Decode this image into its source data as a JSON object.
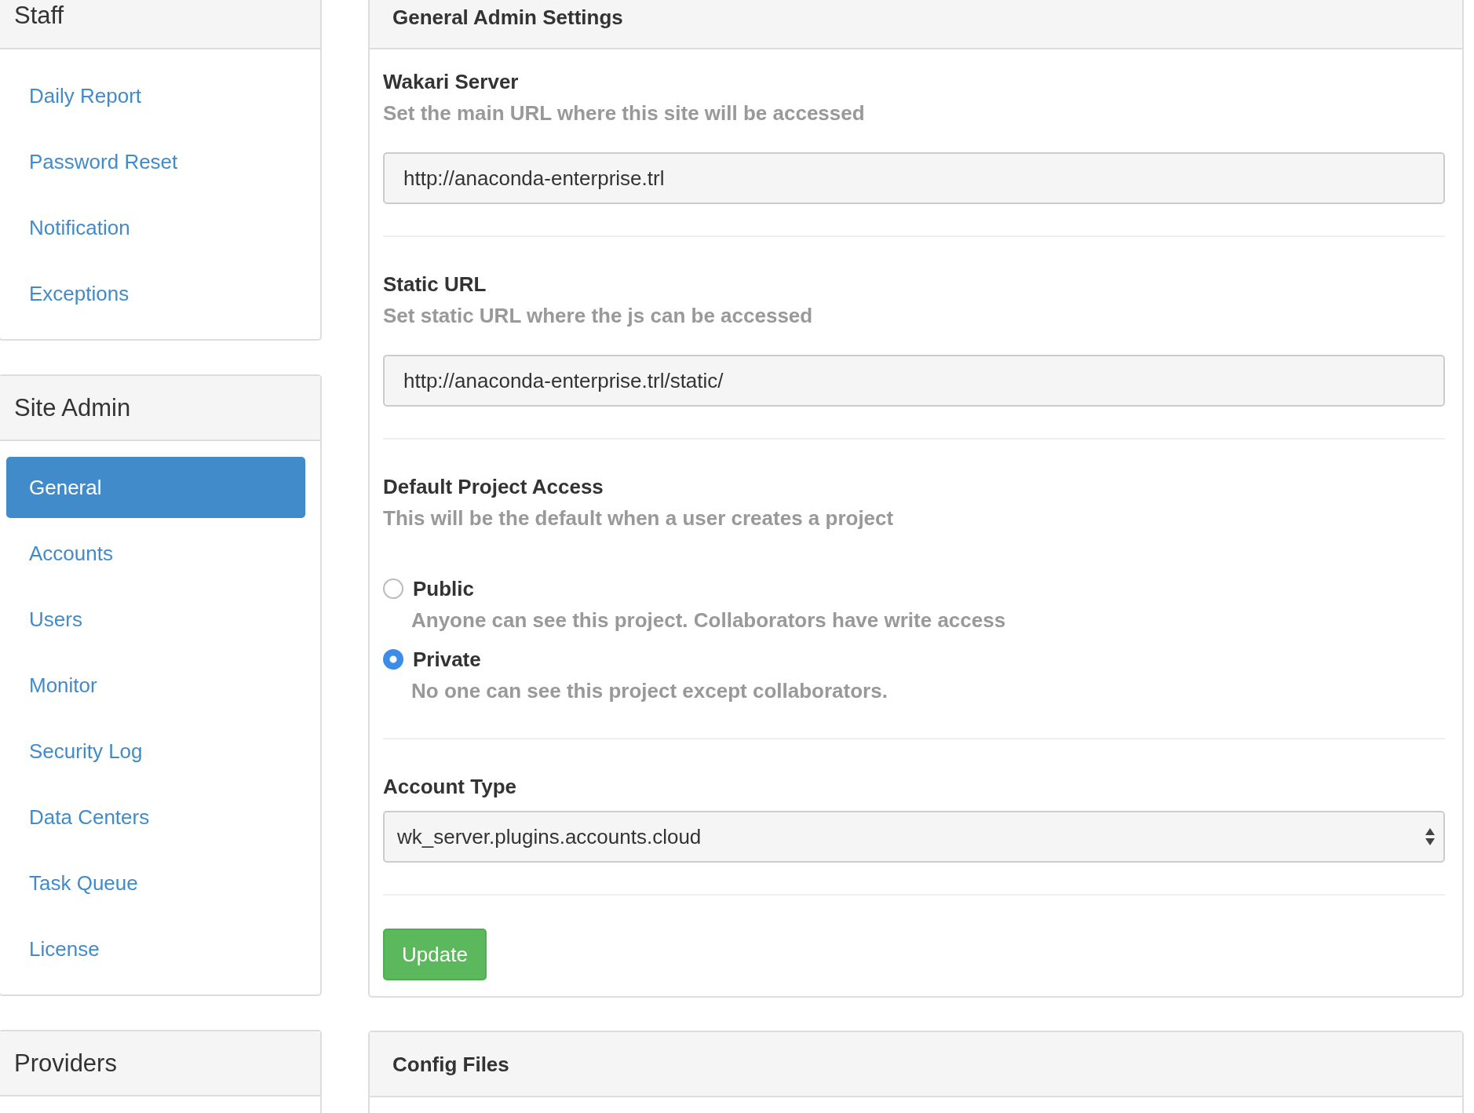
{
  "sidebar": [
    {
      "title": "Staff",
      "items": [
        {
          "label": "Daily Report",
          "selected": false
        },
        {
          "label": "Password Reset",
          "selected": false
        },
        {
          "label": "Notification",
          "selected": false
        },
        {
          "label": "Exceptions",
          "selected": false
        }
      ]
    },
    {
      "title": "Site Admin",
      "items": [
        {
          "label": "General",
          "selected": true
        },
        {
          "label": "Accounts",
          "selected": false
        },
        {
          "label": "Users",
          "selected": false
        },
        {
          "label": "Monitor",
          "selected": false
        },
        {
          "label": "Security Log",
          "selected": false
        },
        {
          "label": "Data Centers",
          "selected": false
        },
        {
          "label": "Task Queue",
          "selected": false
        },
        {
          "label": "License",
          "selected": false
        }
      ]
    },
    {
      "title": "Providers"
    }
  ],
  "general_panel": {
    "title": "General Admin Settings",
    "wakari_server": {
      "label": "Wakari Server",
      "help": "Set the main URL where this site will be accessed",
      "value": "http://anaconda-enterprise.trl"
    },
    "static_url": {
      "label": "Static URL",
      "help": "Set static URL where the js can be accessed",
      "value": "http://anaconda-enterprise.trl/static/"
    },
    "default_project_access": {
      "label": "Default Project Access",
      "help": "This will be the default when a user creates a project",
      "options": [
        {
          "label": "Public",
          "description": "Anyone can see this project. Collaborators have write access",
          "selected": false
        },
        {
          "label": "Private",
          "description": "No one can see this project except collaborators.",
          "selected": true
        }
      ]
    },
    "account_type": {
      "label": "Account Type",
      "value": "wk_server.plugins.accounts.cloud"
    },
    "button": "Update"
  },
  "config_panel": {
    "title": "Config Files"
  }
}
